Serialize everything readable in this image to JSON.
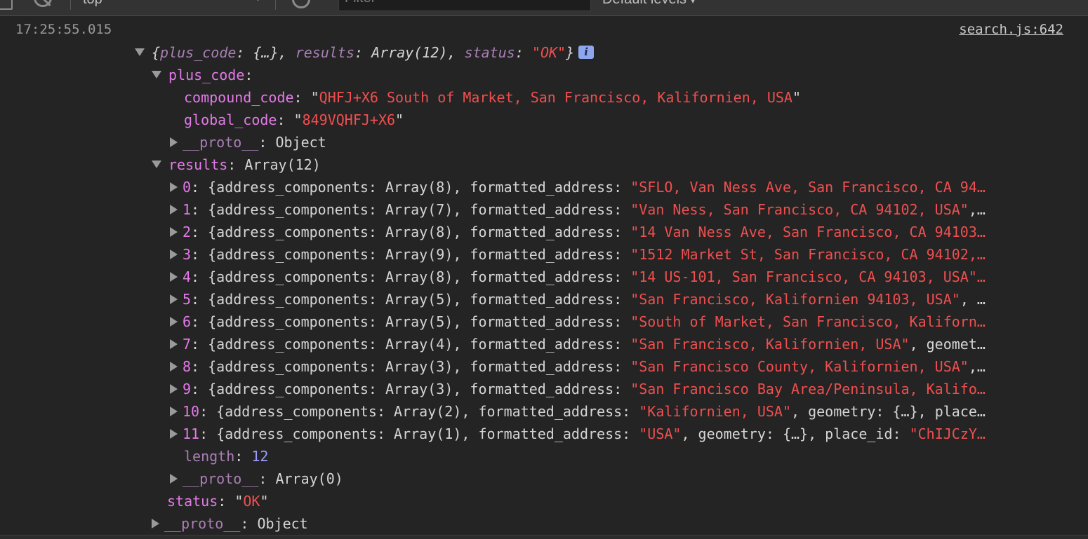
{
  "toolbar": {
    "context": "top",
    "filter_placeholder": "Filter",
    "levels": "Default levels"
  },
  "log": {
    "timestamp": "17:25:55.015",
    "source": "search.js:642"
  },
  "summary": {
    "open_brace": "{",
    "k1": "plus_code",
    "v1": ": {…}, ",
    "k2": "results",
    "v2": ": Array(12), ",
    "k3": "status",
    "colon": ": ",
    "status_value": "\"OK\"",
    "close_brace": "}",
    "info": "i"
  },
  "plus_code": {
    "key": "plus_code",
    "colon": ":",
    "compound_key": "compound_code",
    "compound_value": "QHFJ+X6 South of Market, San Francisco, Kalifornien, USA",
    "global_key": "global_code",
    "global_value": "849VQHFJ+X6",
    "proto_key": "__proto__",
    "proto_value": "Object"
  },
  "results": {
    "key": "results",
    "value": "Array(12)",
    "items": [
      {
        "index": "0",
        "pre": ": {address_components: ",
        "arr": "Array(8)",
        "mid": ", formatted_address: ",
        "addr": "\"SFLO, Van Ness Ave, San Francisco, CA 94…",
        "rest": ""
      },
      {
        "index": "1",
        "pre": ": {address_components: ",
        "arr": "Array(7)",
        "mid": ", formatted_address: ",
        "addr": "\"Van Ness, San Francisco, CA 94102, USA\"",
        "rest": ",…"
      },
      {
        "index": "2",
        "pre": ": {address_components: ",
        "arr": "Array(8)",
        "mid": ", formatted_address: ",
        "addr": "\"14 Van Ness Ave, San Francisco, CA 94103…",
        "rest": ""
      },
      {
        "index": "3",
        "pre": ": {address_components: ",
        "arr": "Array(9)",
        "mid": ", formatted_address: ",
        "addr": "\"1512 Market St, San Francisco, CA 94102,…",
        "rest": ""
      },
      {
        "index": "4",
        "pre": ": {address_components: ",
        "arr": "Array(8)",
        "mid": ", formatted_address: ",
        "addr": "\"14 US-101, San Francisco, CA 94103, USA\"…",
        "rest": ""
      },
      {
        "index": "5",
        "pre": ": {address_components: ",
        "arr": "Array(5)",
        "mid": ", formatted_address: ",
        "addr": "\"San Francisco, Kalifornien 94103, USA\"",
        "rest": ", …"
      },
      {
        "index": "6",
        "pre": ": {address_components: ",
        "arr": "Array(5)",
        "mid": ", formatted_address: ",
        "addr": "\"South of Market, San Francisco, Kaliforn…",
        "rest": ""
      },
      {
        "index": "7",
        "pre": ": {address_components: ",
        "arr": "Array(4)",
        "mid": ", formatted_address: ",
        "addr": "\"San Francisco, Kalifornien, USA\"",
        "rest": ", geomet…"
      },
      {
        "index": "8",
        "pre": ": {address_components: ",
        "arr": "Array(3)",
        "mid": ", formatted_address: ",
        "addr": "\"San Francisco County, Kalifornien, USA\"",
        "rest": ",…"
      },
      {
        "index": "9",
        "pre": ": {address_components: ",
        "arr": "Array(3)",
        "mid": ", formatted_address: ",
        "addr": "\"San Francisco Bay Area/Peninsula, Kalifo…",
        "rest": ""
      },
      {
        "index": "10",
        "pre": ": {address_components: ",
        "arr": "Array(2)",
        "mid": ", formatted_address: ",
        "addr": "\"Kalifornien, USA\"",
        "rest": ", geometry: {…}, place…"
      },
      {
        "index": "11",
        "pre": ": {address_components: ",
        "arr": "Array(1)",
        "mid": ", formatted_address: ",
        "addr": "\"USA\"",
        "rest": ", geometry: {…}, place_id: ",
        "tail": "\"ChIJCzY…"
      }
    ],
    "length_key": "length",
    "length_value": "12",
    "proto_key": "__proto__",
    "proto_value": "Array(0)"
  },
  "status": {
    "key": "status",
    "colon": ": ",
    "quote_open": "\"",
    "value": "OK",
    "quote_close": "\""
  },
  "root_proto": {
    "key": "__proto__",
    "value": "Object"
  }
}
